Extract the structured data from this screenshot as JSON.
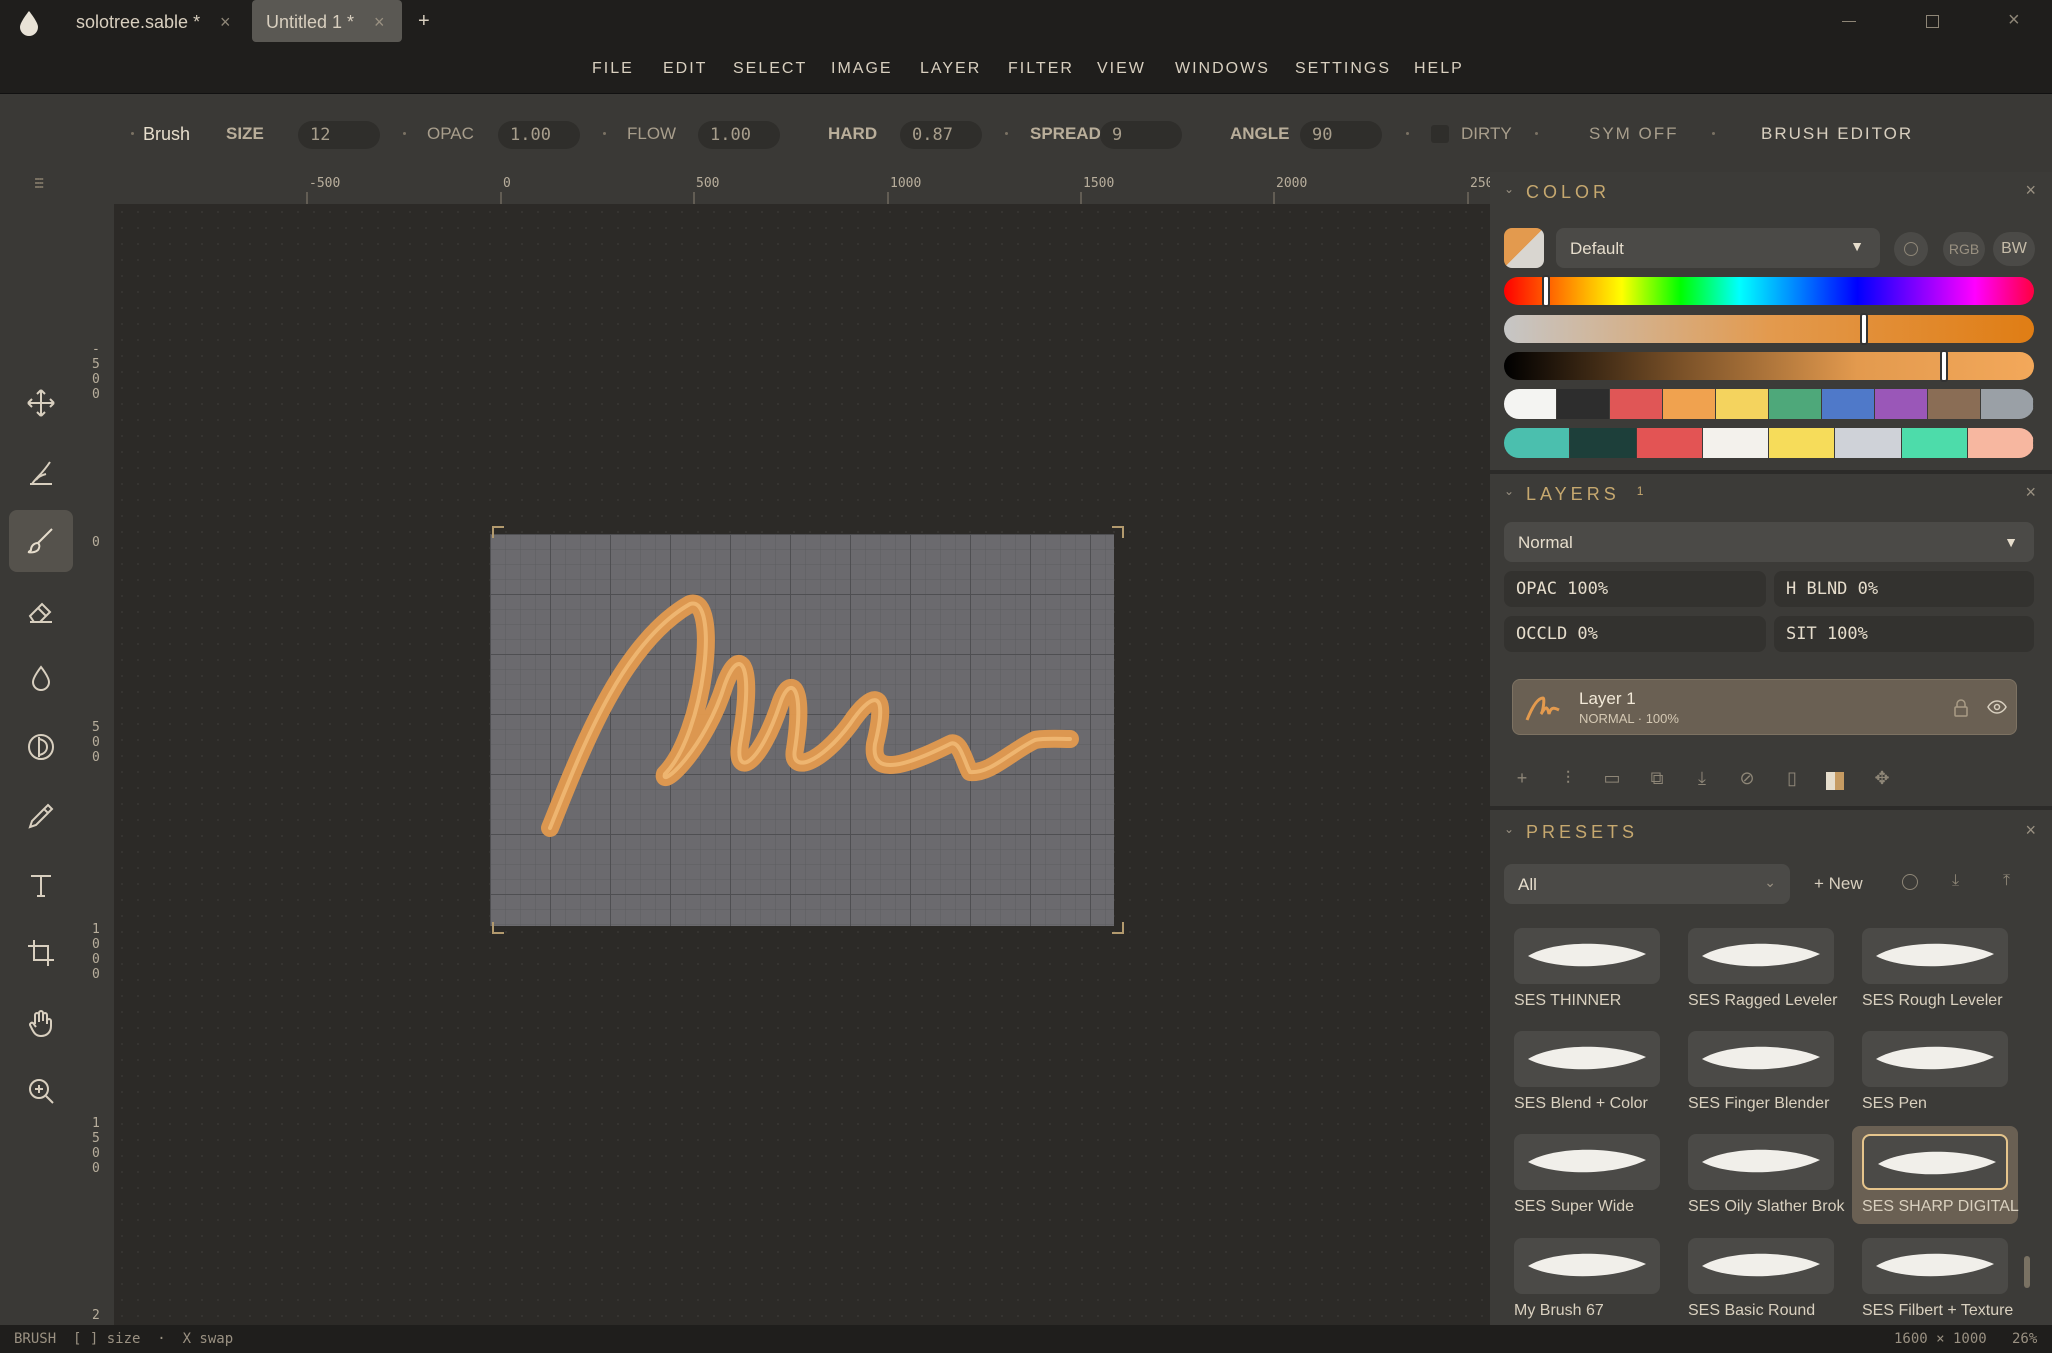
{
  "titlebar": {
    "tabs": [
      {
        "label": "solotree.sable *",
        "active": false
      },
      {
        "label": "Untitled 1 *",
        "active": true
      }
    ],
    "add_tab": "+",
    "close": "×"
  },
  "menu": [
    "FILE",
    "EDIT",
    "SELECT",
    "IMAGE",
    "LAYER",
    "FILTER",
    "VIEW",
    "WINDOWS",
    "SETTINGS",
    "HELP"
  ],
  "tool_options": {
    "tool": "Brush",
    "size_label": "SIZE",
    "size": "12",
    "opac_label": "OPAC",
    "opac": "1.00",
    "flow_label": "FLOW",
    "flow": "1.00",
    "hard_label": "HARD",
    "hard": "0.87",
    "spread_label": "SPREAD",
    "spread": "9",
    "angle_label": "ANGLE",
    "angle": "90",
    "dirty_label": "DIRTY",
    "sym_label": "SYM OFF",
    "brush_editor_label": "BRUSH EDITOR"
  },
  "tools": [
    "move-icon",
    "smudge-icon",
    "brush-icon",
    "eraser-icon",
    "fill-icon",
    "dodge-icon",
    "eyedropper-icon",
    "text-icon",
    "crop-icon",
    "hand-icon",
    "zoom-icon"
  ],
  "active_tool": "brush-icon",
  "ruler": {
    "h": [
      "-500",
      "0",
      "500",
      "1000",
      "1500",
      "2000",
      "250"
    ],
    "v": [
      "-500",
      "0",
      "500",
      "1000",
      "1500",
      "2"
    ]
  },
  "color_panel": {
    "title": "COLOR",
    "palette_name": "Default",
    "mode_rgb": "RGB",
    "mode_bw": "BW",
    "hue": 0.08,
    "saturation": 0.68,
    "value": 0.83,
    "primary_color": "#e39a4e",
    "swatches_row1": [
      "#f4f4f2",
      "#2d2d2d",
      "#e05656",
      "#f0a24f",
      "#f4d35e",
      "#4ea87a",
      "#4f79c9",
      "#9a57b8",
      "#8a6d55",
      "#9aa0a6"
    ],
    "swatches_row2": [
      "#4bbfae",
      "#1d3f3a",
      "#e35454",
      "#f3f1ec",
      "#f6dc5a",
      "#cfd2d8",
      "#4ddcaa",
      "#f7b7a0"
    ]
  },
  "layers_panel": {
    "title": "LAYERS",
    "count": "1",
    "blend_mode": "Normal",
    "opac": "OPAC 100%",
    "h_blnd": "H BLND 0%",
    "occld": "OCCLD 0%",
    "sit": "SIT 100%",
    "layers": [
      {
        "name": "Layer 1",
        "info": "NORMAL · 100%"
      }
    ]
  },
  "presets_panel": {
    "title": "PRESETS",
    "filter": "All",
    "new_label": "+ New",
    "presets": [
      {
        "name": "SES THINNER",
        "selected": false
      },
      {
        "name": "SES Ragged Leveler",
        "selected": false
      },
      {
        "name": "SES Rough Leveler",
        "selected": false
      },
      {
        "name": "SES Blend + Color",
        "selected": false
      },
      {
        "name": "SES Finger Blender",
        "selected": false
      },
      {
        "name": "SES Pen",
        "selected": false
      },
      {
        "name": "SES Super Wide",
        "selected": false
      },
      {
        "name": "SES Oily Slather Brok",
        "selected": false
      },
      {
        "name": "SES SHARP DIGITAL",
        "selected": true
      },
      {
        "name": "My Brush 67",
        "selected": false
      },
      {
        "name": "SES Basic Round",
        "selected": false
      },
      {
        "name": "SES Filbert + Texture",
        "selected": false
      }
    ]
  },
  "statusbar": {
    "left": "BRUSH  [ ] size  ·  X swap",
    "dimensions": "1600 × 1000",
    "zoom": "26%"
  }
}
